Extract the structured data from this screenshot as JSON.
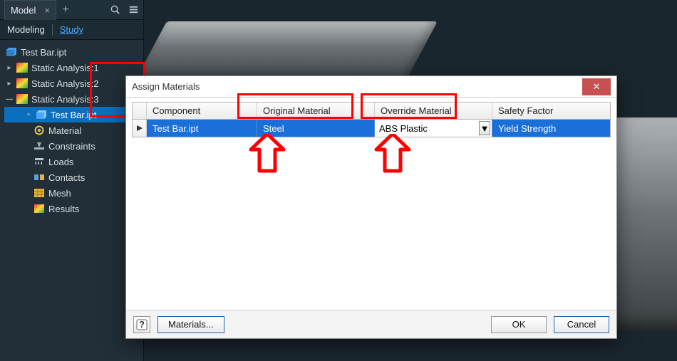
{
  "panel": {
    "tab_label": "Model",
    "modebar": {
      "modeling": "Modeling",
      "study": "Study"
    },
    "root": "Test Bar.ipt",
    "analysis_items": [
      "Static Analysis:1",
      "Static Analysis:2",
      "Static Analysis:3"
    ],
    "a3_children": {
      "testbar": "Test Bar.ipt",
      "material": "Material",
      "constraints": "Constraints",
      "loads": "Loads",
      "contacts": "Contacts",
      "mesh": "Mesh",
      "results": "Results"
    }
  },
  "highlighted_headers": [
    "Original Material",
    "Override Material"
  ],
  "dialog": {
    "title": "Assign Materials",
    "columns": {
      "component": "Component",
      "original": "Original Material",
      "override": "Override Material",
      "safety": "Safety Factor"
    },
    "row": {
      "component": "Test Bar.ipt",
      "original": "Steel",
      "override": "ABS Plastic",
      "safety": "Yield Strength"
    },
    "buttons": {
      "materials": "Materials...",
      "ok": "OK",
      "cancel": "Cancel"
    }
  }
}
